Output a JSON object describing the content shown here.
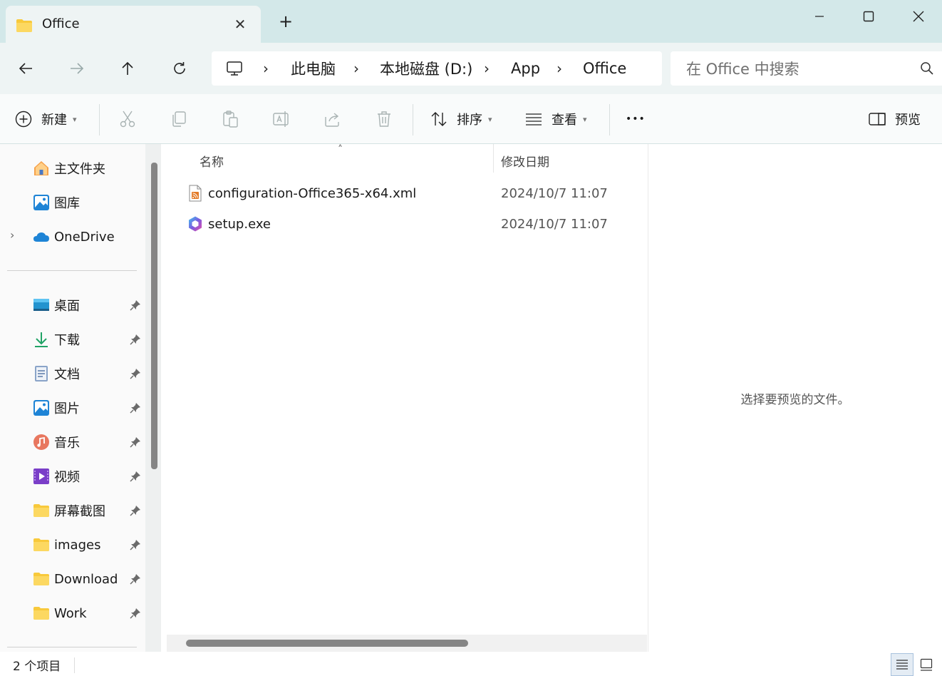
{
  "window": {
    "tab_title": "Office",
    "tab_close": "✕",
    "new_tab": "+"
  },
  "breadcrumb": [
    "此电脑",
    "本地磁盘 (D:)",
    "App",
    "Office"
  ],
  "search": {
    "placeholder": "在 Office 中搜索"
  },
  "toolbar": {
    "new_label": "新建",
    "sort_label": "排序",
    "view_label": "查看",
    "more_label": "•••",
    "preview_label": "预览"
  },
  "sidebar": {
    "top_items": [
      {
        "label": "主文件夹",
        "icon": "home-icon"
      },
      {
        "label": "图库",
        "icon": "gallery-icon"
      },
      {
        "label": "OneDrive",
        "icon": "onedrive-icon"
      }
    ],
    "quick_access": [
      {
        "label": "桌面",
        "icon": "desktop-icon"
      },
      {
        "label": "下载",
        "icon": "download-icon"
      },
      {
        "label": "文档",
        "icon": "documents-icon"
      },
      {
        "label": "图片",
        "icon": "pictures-icon"
      },
      {
        "label": "音乐",
        "icon": "music-icon"
      },
      {
        "label": "视频",
        "icon": "videos-icon"
      },
      {
        "label": "屏幕截图",
        "icon": "folder-icon"
      },
      {
        "label": "images",
        "icon": "folder-icon"
      },
      {
        "label": "Download",
        "icon": "folder-icon"
      },
      {
        "label": "Work",
        "icon": "folder-icon"
      }
    ]
  },
  "file_list": {
    "columns": {
      "name": "名称",
      "modified": "修改日期"
    },
    "files": [
      {
        "name": "configuration-Office365-x64.xml",
        "modified": "2024/10/7 11:07",
        "icon": "xml-file-icon"
      },
      {
        "name": "setup.exe",
        "modified": "2024/10/7 11:07",
        "icon": "office-setup-icon"
      }
    ]
  },
  "preview_pane": {
    "message": "选择要预览的文件。"
  },
  "status": {
    "item_count": "2 个项目"
  },
  "colors": {
    "accent": "#0067c0",
    "titlebar": "#d3e8e9",
    "navbar": "#eef4f4",
    "folder": "#f8c93b"
  }
}
